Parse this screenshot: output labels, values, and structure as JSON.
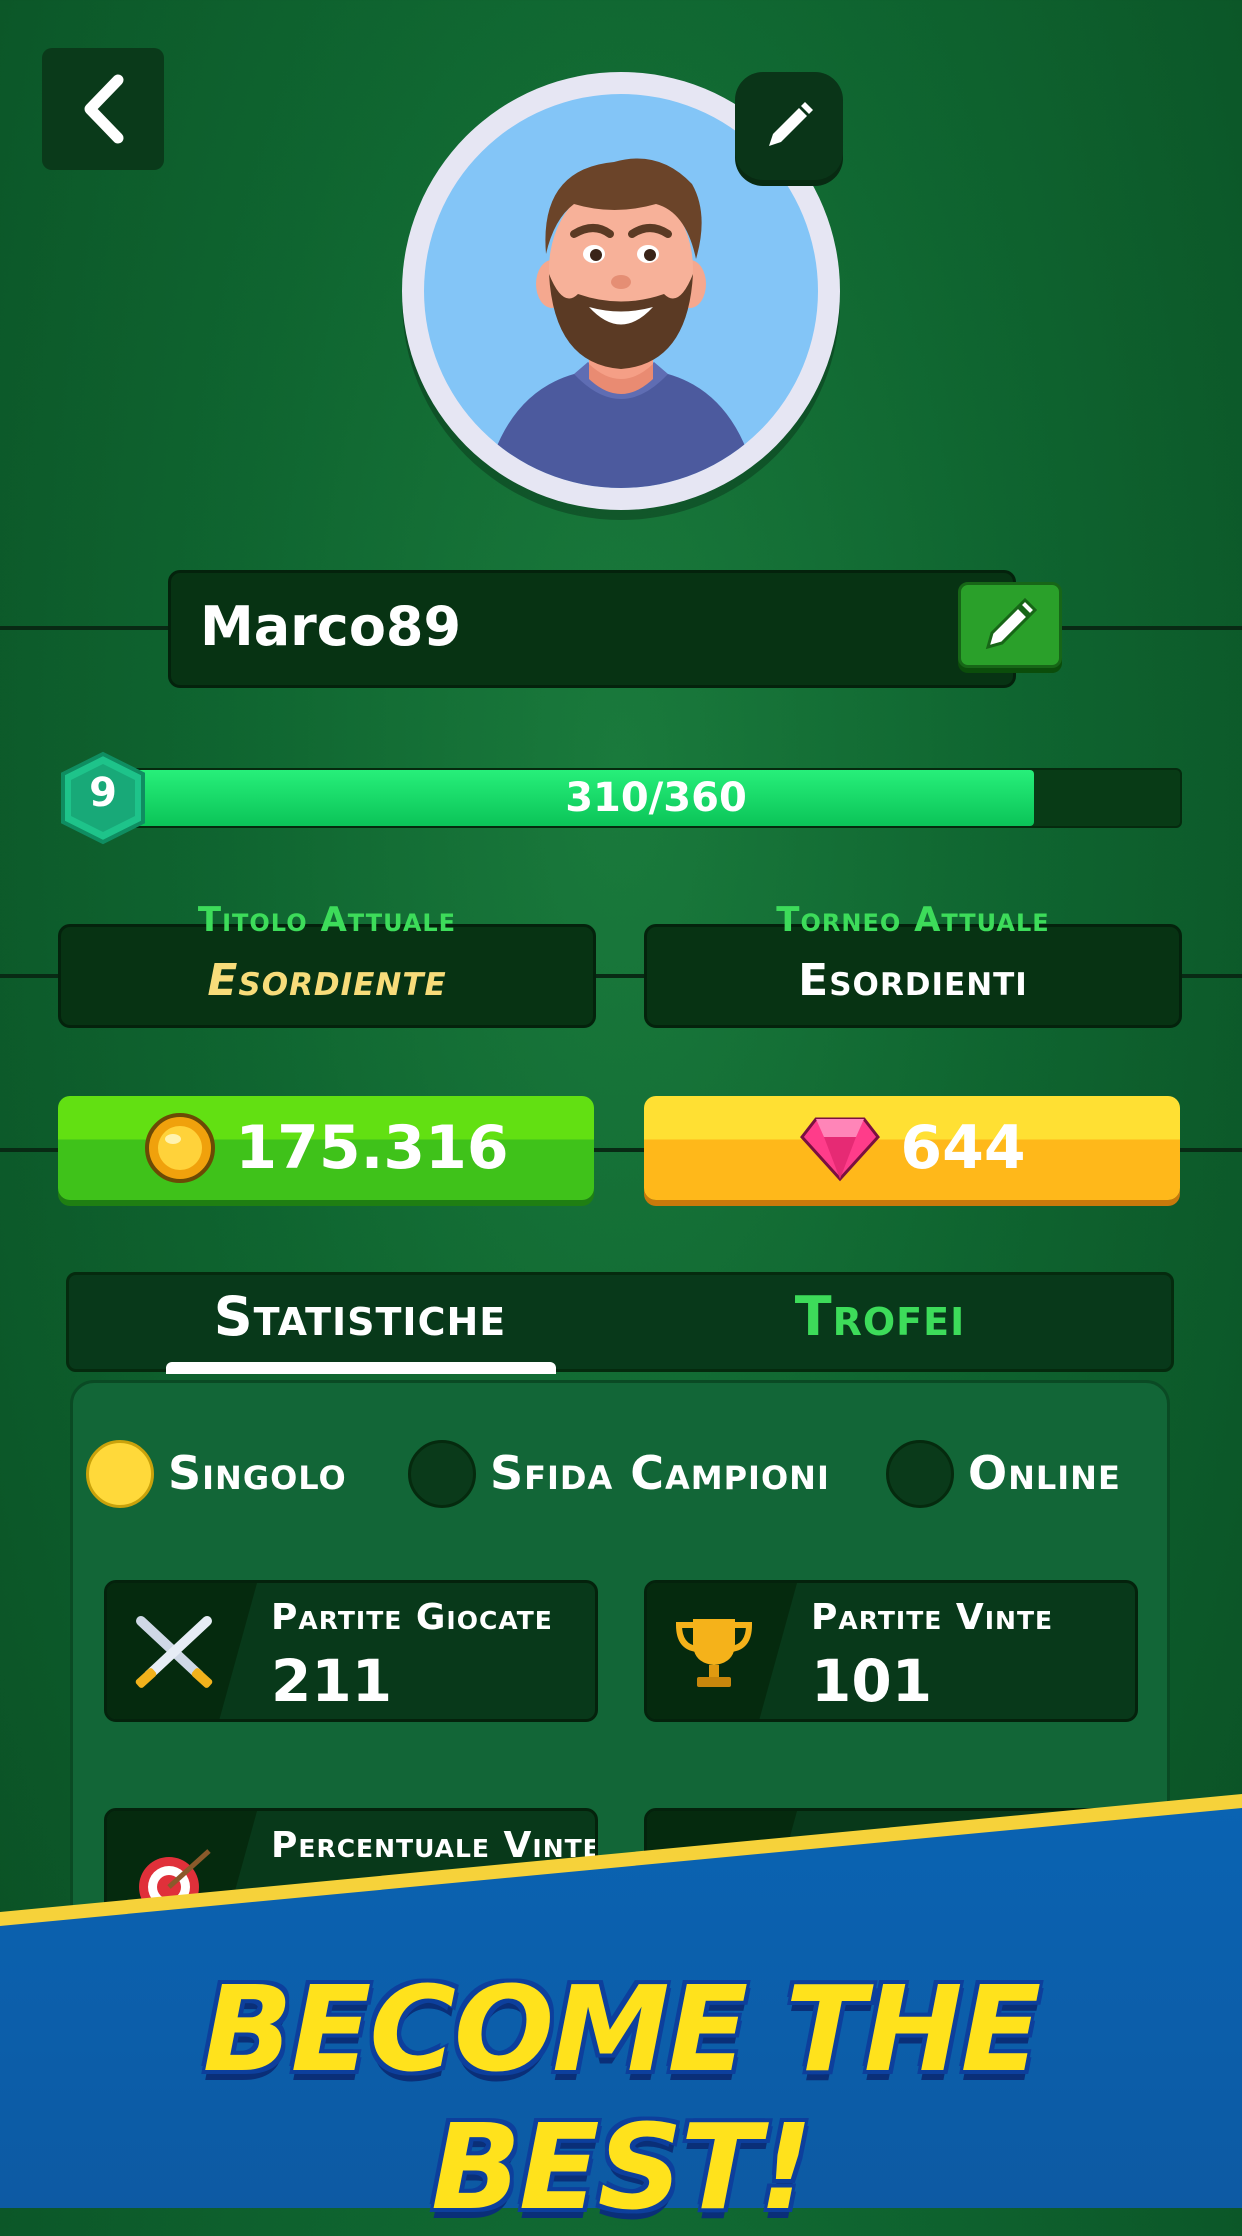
{
  "profile": {
    "name": "Marco89",
    "level": "9",
    "xp_text": "310/360",
    "xp_progress": 0.861
  },
  "info": {
    "title_label": "Titolo Attuale",
    "title_value": "Esordiente",
    "tournament_label": "Torneo Attuale",
    "tournament_value": "Esordienti"
  },
  "currency": {
    "coins": "175.316",
    "gems": "644"
  },
  "tabs": {
    "stats": "Statistiche",
    "trophies": "Trofei",
    "active": "stats"
  },
  "modes": [
    {
      "label": "Singolo",
      "selected": true
    },
    {
      "label": "Sfida Campioni",
      "selected": false
    },
    {
      "label": "Online",
      "selected": false
    }
  ],
  "stats": [
    {
      "label": "Partite Giocate",
      "value": "211",
      "icon": "crossed-swords-icon"
    },
    {
      "label": "Partite Vinte",
      "value": "101",
      "icon": "trophy-icon"
    },
    {
      "label": "Percentuale Vinte",
      "value": "",
      "icon": "target-icon"
    },
    {
      "label": "",
      "value": "",
      "icon": "leaf-icon"
    }
  ],
  "banner": {
    "text": "BECOME THE BEST!"
  },
  "colors": {
    "accent_green": "#3ddc5a",
    "progress_fill": "#14d35f",
    "coin_button": "#4cd015",
    "gem_button": "#ffc21f",
    "banner_blue": "#0a63b2",
    "banner_text": "#ffe21c"
  }
}
